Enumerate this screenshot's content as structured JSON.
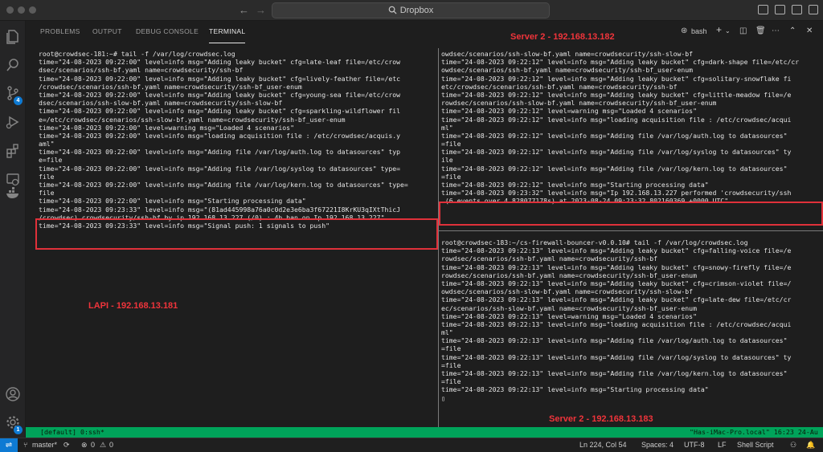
{
  "window": {
    "search_text": "Dropbox"
  },
  "panel": {
    "tabs": [
      {
        "label": "PROBLEMS"
      },
      {
        "label": "OUTPUT"
      },
      {
        "label": "DEBUG CONSOLE"
      },
      {
        "label": "TERMINAL",
        "active": true
      }
    ],
    "shell_label": "bash"
  },
  "activity": {
    "scm_badge": "4",
    "settings_badge": "1"
  },
  "annotations": {
    "server2_top": "Server 2 - 192.168.13.182",
    "lapi": "LAPI - 192.168.13.181",
    "server2_bottom": "Server 2 - 192.168.13.183"
  },
  "terminal": {
    "left": [
      "root@crowdsec-181:~# tail -f /var/log/crowdsec.log",
      "time=\"24-08-2023 09:22:00\" level=info msg=\"Adding leaky bucket\" cfg=late-leaf file=/etc/crow",
      "dsec/scenarios/ssh-bf.yaml name=crowdsecurity/ssh-bf",
      "time=\"24-08-2023 09:22:00\" level=info msg=\"Adding leaky bucket\" cfg=lively-feather file=/etc",
      "/crowdsec/scenarios/ssh-bf.yaml name=crowdsecurity/ssh-bf_user-enum",
      "time=\"24-08-2023 09:22:00\" level=info msg=\"Adding leaky bucket\" cfg=young-sea file=/etc/crow",
      "dsec/scenarios/ssh-slow-bf.yaml name=crowdsecurity/ssh-slow-bf",
      "time=\"24-08-2023 09:22:00\" level=info msg=\"Adding leaky bucket\" cfg=sparkling-wildflower fil",
      "e=/etc/crowdsec/scenarios/ssh-slow-bf.yaml name=crowdsecurity/ssh-bf_user-enum",
      "time=\"24-08-2023 09:22:00\" level=warning msg=\"Loaded 4 scenarios\"",
      "time=\"24-08-2023 09:22:00\" level=info msg=\"loading acquisition file : /etc/crowdsec/acquis.y",
      "aml\"",
      "time=\"24-08-2023 09:22:00\" level=info msg=\"Adding file /var/log/auth.log to datasources\" typ",
      "e=file",
      "time=\"24-08-2023 09:22:00\" level=info msg=\"Adding file /var/log/syslog to datasources\" type=",
      "file",
      "time=\"24-08-2023 09:22:00\" level=info msg=\"Adding file /var/log/kern.log to datasources\" type=",
      "file",
      "time=\"24-08-2023 09:22:00\" level=info msg=\"Starting processing data\"",
      "time=\"24-08-2023 09:23:33\" level=info msg=\"(81ad445998a76a0c0d2e3e6ba3f67221I8KrKU3qIXtThicJ",
      "/crowdsec) crowdsecurity/ssh-bf by ip 192.168.13.227 (/0) : 4h ban on Ip 192.168.13.227\"",
      "time=\"24-08-2023 09:23:33\" level=info msg=\"Signal push: 1 signals to push\""
    ],
    "right_top": [
      "owdsec/scenarios/ssh-slow-bf.yaml name=crowdsecurity/ssh-slow-bf",
      "time=\"24-08-2023 09:22:12\" level=info msg=\"Adding leaky bucket\" cfg=dark-shape file=/etc/cr",
      "owdsec/scenarios/ssh-bf.yaml name=crowdsecurity/ssh-bf_user-enum",
      "time=\"24-08-2023 09:22:12\" level=info msg=\"Adding leaky bucket\" cfg=solitary-snowflake fi",
      "etc/crowdsec/scenarios/ssh-bf.yaml name=crowdsecurity/ssh-bf",
      "time=\"24-08-2023 09:22:12\" level=info msg=\"Adding leaky bucket\" cfg=little-meadow file=/e",
      "rowdsec/scenarios/ssh-slow-bf.yaml name=crowdsecurity/ssh-bf_user-enum",
      "time=\"24-08-2023 09:22:12\" level=warning msg=\"Loaded 4 scenarios\"",
      "time=\"24-08-2023 09:22:12\" level=info msg=\"loading acquisition file : /etc/crowdsec/acqui",
      "ml\"",
      "time=\"24-08-2023 09:22:12\" level=info msg=\"Adding file /var/log/auth.log to datasources\"",
      "=file",
      "time=\"24-08-2023 09:22:12\" level=info msg=\"Adding file /var/log/syslog to datasources\" ty",
      "ile",
      "time=\"24-08-2023 09:22:12\" level=info msg=\"Adding file /var/log/kern.log to datasources\"",
      "=file",
      "time=\"24-08-2023 09:22:12\" level=info msg=\"Starting processing data\"",
      "time=\"24-08-2023 09:23:32\" level=info msg=\"Ip 192.168.13.227 performed 'crowdsecurity/ssh",
      " (6 events over 4.828077178s) at 2023-08-24 09:23:32.802160369 +0000 UTC\""
    ],
    "right_bottom": [
      "root@crowdsec-183:~/cs-firewall-bouncer-v0.0.10# tail -f /var/log/crowdsec.log",
      "time=\"24-08-2023 09:22:13\" level=info msg=\"Adding leaky bucket\" cfg=falling-voice file=/e",
      "rowdsec/scenarios/ssh-bf.yaml name=crowdsecurity/ssh-bf",
      "time=\"24-08-2023 09:22:13\" level=info msg=\"Adding leaky bucket\" cfg=snowy-firefly file=/e",
      "rowdsec/scenarios/ssh-bf.yaml name=crowdsecurity/ssh-bf_user-enum",
      "time=\"24-08-2023 09:22:13\" level=info msg=\"Adding leaky bucket\" cfg=crimson-violet file=/",
      "owdsec/scenarios/ssh-slow-bf.yaml name=crowdsecurity/ssh-slow-bf",
      "time=\"24-08-2023 09:22:13\" level=info msg=\"Adding leaky bucket\" cfg=late-dew file=/etc/cr",
      "ec/scenarios/ssh-slow-bf.yaml name=crowdsecurity/ssh-bf_user-enum",
      "time=\"24-08-2023 09:22:13\" level=warning msg=\"Loaded 4 scenarios\"",
      "time=\"24-08-2023 09:22:13\" level=info msg=\"loading acquisition file : /etc/crowdsec/acqui",
      "ml\"",
      "time=\"24-08-2023 09:22:13\" level=info msg=\"Adding file /var/log/auth.log to datasources\"",
      "=file",
      "time=\"24-08-2023 09:22:13\" level=info msg=\"Adding file /var/log/syslog to datasources\" ty",
      "=file",
      "time=\"24-08-2023 09:22:13\" level=info msg=\"Adding file /var/log/kern.log to datasources\"",
      "=file",
      "time=\"24-08-2023 09:22:13\" level=info msg=\"Starting processing data\"",
      "▯"
    ]
  },
  "tmux": {
    "left": "[default] 0:ssh*",
    "right": "\"Has-iMac-Pro.local\" 16:23 24-Au"
  },
  "statusbar": {
    "branch": "master*",
    "errors": "0",
    "warnings": "0",
    "position": "Ln 224, Col 54",
    "spaces": "Spaces: 4",
    "encoding": "UTF-8",
    "eol": "LF",
    "language": "Shell Script"
  },
  "colors": {
    "accent": "#0e7ad3",
    "annotation": "#e0313a",
    "tmux_bar": "#00a35a"
  }
}
